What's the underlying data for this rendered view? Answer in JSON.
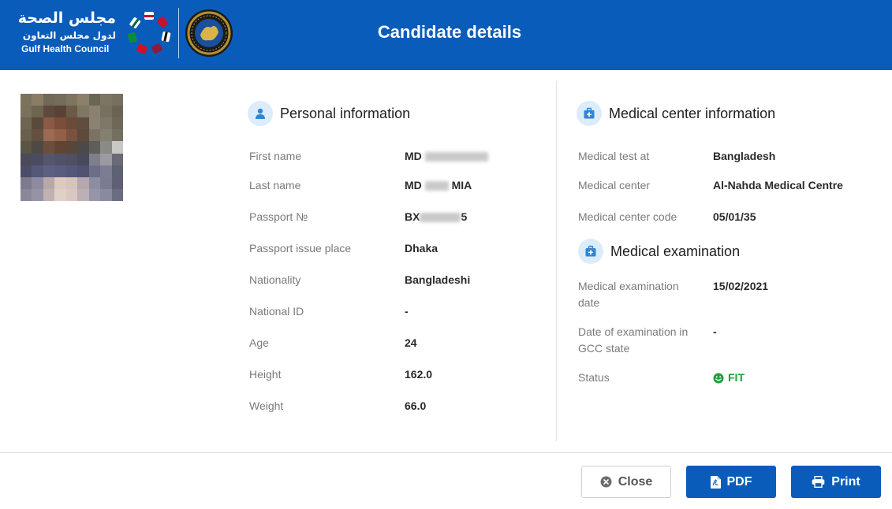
{
  "header": {
    "logo_arabic_line1": "مجلس الصحة",
    "logo_arabic_line2": "لدول مجلس التعاون",
    "logo_english": "Gulf Health Council",
    "title": "Candidate details"
  },
  "personal": {
    "title": "Personal information",
    "fields": [
      {
        "label": "First name",
        "value": "MD"
      },
      {
        "label": "Last name",
        "value": "MD",
        "suffix": "MIA"
      },
      {
        "label": "Passport №",
        "value": "BX",
        "suffix": "5"
      },
      {
        "label": "Passport issue place",
        "value": "Dhaka"
      },
      {
        "label": "Nationality",
        "value": "Bangladeshi"
      },
      {
        "label": "National ID",
        "value": "-"
      },
      {
        "label": "Age",
        "value": "24"
      },
      {
        "label": "Height",
        "value": "162.0"
      },
      {
        "label": "Weight",
        "value": "66.0"
      }
    ]
  },
  "medical_center": {
    "title": "Medical center information",
    "fields": [
      {
        "label": "Medical test at",
        "value": "Bangladesh"
      },
      {
        "label": "Medical center",
        "value": "Al-Nahda Medical Centre"
      },
      {
        "label": "Medical center code",
        "value": "05/01/35"
      }
    ]
  },
  "medical_exam": {
    "title": "Medical examination",
    "fields": [
      {
        "label": "Medical examination date",
        "value": "15/02/2021"
      },
      {
        "label": "Date of examination in GCC state",
        "value": "-"
      },
      {
        "label": "Status",
        "value": "FIT"
      }
    ]
  },
  "buttons": {
    "close": "Close",
    "pdf": "PDF",
    "print": "Print"
  },
  "colors": {
    "brand_blue": "#0a5cba",
    "status_fit": "#1aa33a",
    "icon_bg": "#dcecfa"
  },
  "icons": {
    "personal": "user-icon",
    "medical_center": "medical-kit-icon",
    "medical_exam": "medical-kit-icon",
    "status": "smile-icon",
    "close": "close-circle-icon",
    "pdf": "pdf-file-icon",
    "print": "printer-icon"
  }
}
